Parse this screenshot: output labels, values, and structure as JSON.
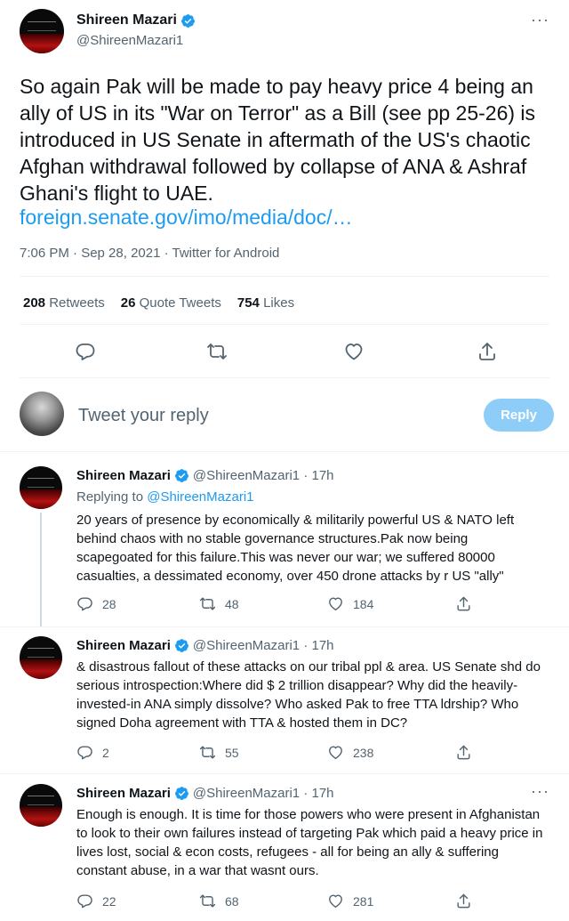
{
  "main": {
    "name": "Shireen Mazari",
    "handle": "@ShireenMazari1",
    "more": "···",
    "text": "So again Pak will be made to pay heavy price 4 being an ally of US in its \"War on Terror\" as a Bill (see pp 25-26) is introduced in US Senate in aftermath of the US's chaotic Afghan withdrawal followed by collapse of ANA & Ashraf Ghani's flight to UAE.",
    "link": "foreign.senate.gov/imo/media/doc/…",
    "time": "7:06 PM · Sep 28, 2021 · Twitter for Android",
    "retweets_count": "208",
    "retweets_label": "Retweets",
    "quotes_count": "26",
    "quotes_label": "Quote Tweets",
    "likes_count": "754",
    "likes_label": "Likes"
  },
  "reply_box": {
    "placeholder": "Tweet your reply",
    "button": "Reply"
  },
  "replies": [
    {
      "name": "Shireen Mazari",
      "handle": "@ShireenMazari1 · 17h",
      "replying_prefix": "Replying to",
      "replying_to": "@ShireenMazari1",
      "text": "20 years of presence by economically & militarily powerful US & NATO left behind chaos with no stable governance structures.Pak now being scapegoated for this failure.This was never our war; we suffered 80000 casualties, a dessimated economy, over 450 drone attacks by r US \"ally\"",
      "replies": "28",
      "retweets": "48",
      "likes": "184"
    },
    {
      "name": "Shireen Mazari",
      "handle": "@ShireenMazari1 · 17h",
      "text": "& disastrous fallout of these attacks on our tribal ppl & area. US Senate shd do serious introspection:Where did $ 2 trillion disappear? Why did the heavily-invested-in ANA simply dissolve? Who asked Pak to free TTA ldrship? Who signed Doha agreement with TTA & hosted them in DC?",
      "replies": "2",
      "retweets": "55",
      "likes": "238"
    },
    {
      "name": "Shireen Mazari",
      "handle": "@ShireenMazari1 · 17h",
      "more": "···",
      "text": "Enough is enough. It is time for those powers who were present in Afghanistan to look to their own failures instead of targeting Pak which paid a heavy price in lives lost, social & econ costs, refugees - all for being an ally & suffering constant abuse, in a war that wasnt ours.",
      "replies": "22",
      "retweets": "68",
      "likes": "281"
    }
  ],
  "colors": {
    "accent": "#1d9bf0",
    "secondary_text": "#536471",
    "reply_button_disabled": "#8ecdf7"
  },
  "icons": [
    "verified-badge-icon",
    "more-icon",
    "reply-icon",
    "retweet-icon",
    "like-icon",
    "share-icon"
  ]
}
